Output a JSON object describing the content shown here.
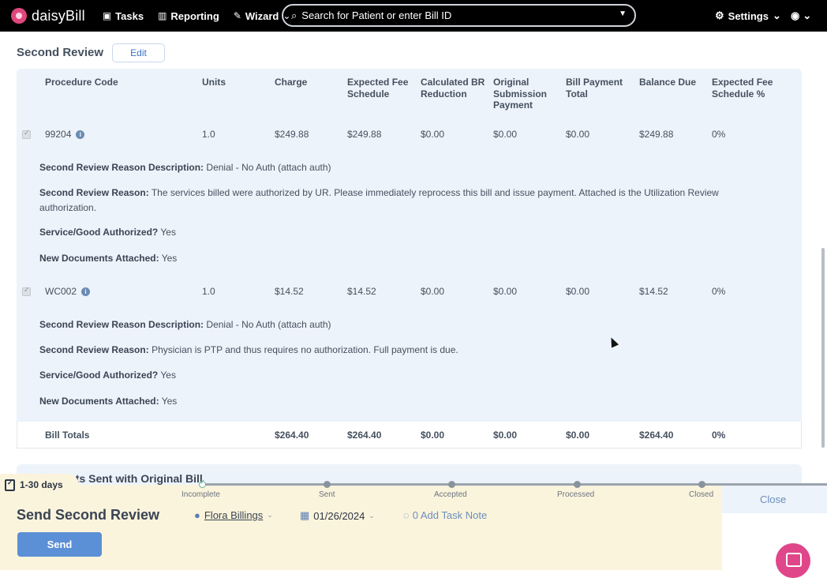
{
  "nav": {
    "logo": "daisyBill",
    "tasks": "Tasks",
    "reporting": "Reporting",
    "wizard": "Wizard",
    "search_placeholder": "Search for Patient or enter Bill ID",
    "settings": "Settings"
  },
  "section": {
    "title": "Second Review",
    "edit_label": "Edit"
  },
  "table": {
    "headers": [
      "Procedure Code",
      "Units",
      "Charge",
      "Expected Fee Schedule",
      "Calculated BR Reduction",
      "Original Submission Payment",
      "Bill Payment Total",
      "Balance Due",
      "Expected Fee Schedule %"
    ],
    "rows": [
      {
        "code": "99204",
        "units": "1.0",
        "charge": "$249.88",
        "expected_fee": "$249.88",
        "br_reduction": "$0.00",
        "original_payment": "$0.00",
        "bill_payment_total": "$0.00",
        "balance_due": "$249.88",
        "fee_pct": "0%",
        "details": {
          "reason_desc_label": "Second Review Reason Description:",
          "reason_desc": "Denial - No Auth (attach auth)",
          "reason_label": "Second Review Reason:",
          "reason": "The services billed were authorized by UR. Please immediately reprocess this bill and issue payment. Attached is the Utilization Review authorization.",
          "authorized_label": "Service/Good Authorized?",
          "authorized": "Yes",
          "new_docs_label": "New Documents Attached:",
          "new_docs": "Yes"
        }
      },
      {
        "code": "WC002",
        "units": "1.0",
        "charge": "$14.52",
        "expected_fee": "$14.52",
        "br_reduction": "$0.00",
        "original_payment": "$0.00",
        "bill_payment_total": "$0.00",
        "balance_due": "$14.52",
        "fee_pct": "0%",
        "details": {
          "reason_desc_label": "Second Review Reason Description:",
          "reason_desc": "Denial - No Auth (attach auth)",
          "reason_label": "Second Review Reason:",
          "reason": "Physician is PTP and thus requires no authorization. Full payment is due.",
          "authorized_label": "Service/Good Authorized?",
          "authorized": "Yes",
          "new_docs_label": "New Documents Attached:",
          "new_docs": "Yes"
        }
      }
    ],
    "totals": {
      "label": "Bill Totals",
      "charge": "$264.40",
      "expected_fee": "$264.40",
      "br_reduction": "$0.00",
      "original_payment": "$0.00",
      "bill_payment_total": "$0.00",
      "balance_due": "$264.40",
      "fee_pct": "0%"
    }
  },
  "docs_section_title": "Documents Sent with Original Bill",
  "task": {
    "tag": "1-30 days",
    "stages": [
      "Incomplete",
      "Sent",
      "Accepted",
      "Processed",
      "Closed"
    ],
    "close_label": "Close",
    "title": "Send Second Review",
    "assignee": "Flora Billings",
    "date": "01/26/2024",
    "note": "0 Add Task Note",
    "send_label": "Send"
  }
}
